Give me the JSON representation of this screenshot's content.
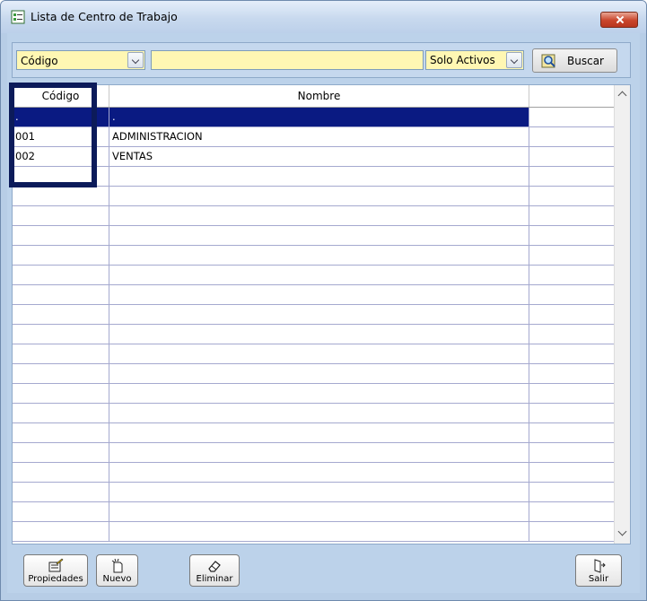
{
  "window": {
    "title": "Lista de Centro de Trabajo"
  },
  "filters": {
    "field_value": "Código",
    "search_value": "",
    "status_value": "Solo Activos",
    "search_button": "Buscar"
  },
  "grid": {
    "columns": [
      "Código",
      "Nombre",
      ""
    ],
    "rows": [
      {
        "codigo": ".",
        "nombre": ".",
        "selected": true
      },
      {
        "codigo": "001",
        "nombre": "ADMINISTRACION",
        "selected": false
      },
      {
        "codigo": "002",
        "nombre": "VENTAS",
        "selected": false
      }
    ],
    "empty_row_count": 19
  },
  "actions": {
    "properties": "Propiedades",
    "new": "Nuevo",
    "delete": "Eliminar",
    "exit": "Salir"
  },
  "colors": {
    "selection": "#0a1a82",
    "field_bg": "#fff7b3",
    "window_bg": "#bcd2ea",
    "highlight": "#0c1b5a"
  }
}
